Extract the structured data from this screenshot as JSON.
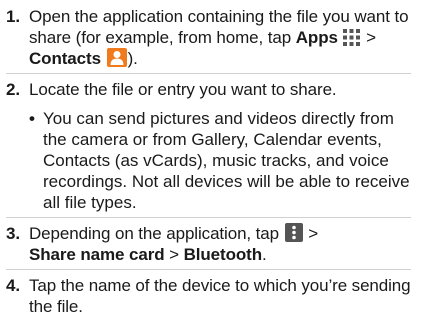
{
  "steps": [
    {
      "num": "1.",
      "parts": {
        "a": "Open the application containing the file you want to share (for example, from home, tap ",
        "apps": "Apps",
        "sep1": " > ",
        "contacts": "Contacts",
        "end": ")."
      }
    },
    {
      "num": "2.",
      "text": "Locate the file or entry you want to share.",
      "bullet": "•",
      "bullet_text": "You can send pictures and videos directly from the camera or from Gallery, Calendar events, Contacts (as vCards), music tracks, and voice recordings. Not all devices will be able to receive all file types."
    },
    {
      "num": "3.",
      "parts": {
        "a": "Depending on the application, tap ",
        "sep1": " > ",
        "share": "Share name card",
        "sep2": " > ",
        "bluetooth": "Bluetooth",
        "end": "."
      }
    },
    {
      "num": "4.",
      "text": "Tap the name of the device to which you’re sending the file."
    }
  ],
  "icons": {
    "apps": "apps-grid-icon",
    "contacts": "contacts-person-icon",
    "menu": "overflow-menu-icon"
  },
  "colors": {
    "contacts_icon": "#f07a1e",
    "menu_icon": "#555555",
    "apps_icon": "#555555",
    "separator": "#d0d0d0"
  }
}
